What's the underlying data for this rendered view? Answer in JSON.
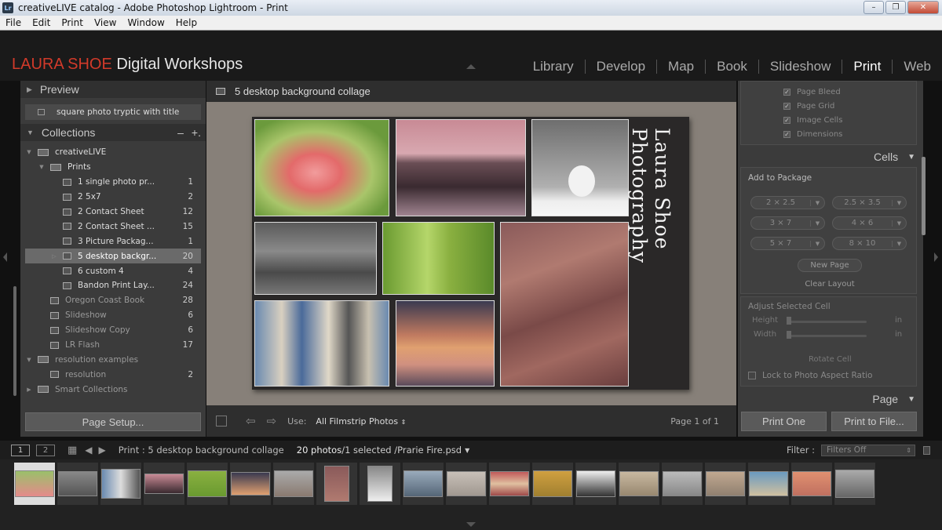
{
  "window": {
    "title": "creativeLIVE catalog - Adobe Photoshop Lightroom - Print",
    "app_icon": "Lr",
    "minimize": "–",
    "maximize": "❐",
    "close": "✕"
  },
  "menu": [
    "File",
    "Edit",
    "Print",
    "View",
    "Window",
    "Help"
  ],
  "brand": {
    "part1": "LAURA SHOE",
    "part2": "Digital Workshops",
    "color1": "#d23a2a"
  },
  "modules": [
    "Library",
    "Develop",
    "Map",
    "Book",
    "Slideshow",
    "Print",
    "Web"
  ],
  "active_module": "Print",
  "left": {
    "preview_label": "Preview",
    "template_label": "square photo tryptic with title",
    "collections_label": "Collections",
    "collections_actions": [
      "–",
      "+."
    ],
    "tree": [
      {
        "label": "creativeLIVE",
        "count": "",
        "depth": 1,
        "type": "set",
        "state": "open"
      },
      {
        "label": "Prints",
        "count": "",
        "depth": 2,
        "type": "set",
        "state": "open"
      },
      {
        "label": "1 single photo pr...",
        "count": "1",
        "depth": 3,
        "type": "print"
      },
      {
        "label": "2 5x7",
        "count": "2",
        "depth": 3,
        "type": "print"
      },
      {
        "label": "2 Contact Sheet",
        "count": "12",
        "depth": 3,
        "type": "print"
      },
      {
        "label": "2 Contact Sheet ...",
        "count": "15",
        "depth": 3,
        "type": "print"
      },
      {
        "label": "3 Picture Packag...",
        "count": "1",
        "depth": 3,
        "type": "print"
      },
      {
        "label": "5 desktop backgr...",
        "count": "20",
        "depth": 3,
        "type": "print",
        "selected": true
      },
      {
        "label": "6 custom 4",
        "count": "4",
        "depth": 3,
        "type": "print"
      },
      {
        "label": "Bandon Print Lay...",
        "count": "24",
        "depth": 3,
        "type": "print"
      },
      {
        "label": "Oregon Coast Book",
        "count": "28",
        "depth": 2,
        "type": "book",
        "dim": true
      },
      {
        "label": "Slideshow",
        "count": "6",
        "depth": 2,
        "type": "slideshow",
        "dim": true
      },
      {
        "label": "Slideshow Copy",
        "count": "6",
        "depth": 2,
        "type": "slideshow",
        "dim": true
      },
      {
        "label": "LR Flash",
        "count": "17",
        "depth": 2,
        "type": "web",
        "dim": true
      },
      {
        "label": "resolution examples",
        "count": "",
        "depth": 1,
        "type": "set",
        "state": "open",
        "dim": true
      },
      {
        "label": "resolution",
        "count": "2",
        "depth": 2,
        "type": "collection",
        "dim": true
      },
      {
        "label": "Smart Collections",
        "count": "",
        "depth": 1,
        "type": "set",
        "state": "closed",
        "dim": true
      }
    ],
    "page_setup": "Page Setup..."
  },
  "center": {
    "title": "5 desktop background collage",
    "vertical_text": "Laura Shoe Photography",
    "footer": {
      "use_label": "Use:",
      "use_value": "All Filmstrip Photos",
      "page": "Page 1 of 1"
    }
  },
  "right": {
    "guides": [
      "Page Bleed",
      "Page Grid",
      "Image Cells",
      "Dimensions"
    ],
    "cells_label": "Cells",
    "add_to_package": "Add to Package",
    "sizes": [
      "2 × 2.5",
      "2.5 × 3.5",
      "3 × 7",
      "4 × 6",
      "5 × 7",
      "8 × 10"
    ],
    "new_page": "New Page",
    "clear_layout": "Clear Layout",
    "adjust_label": "Adjust Selected Cell",
    "height_label": "Height",
    "width_label": "Width",
    "unit": "in",
    "rotate": "Rotate Cell",
    "lock": "Lock to Photo Aspect Ratio",
    "page_label": "Page",
    "print_one": "Print One",
    "print_file": "Print to File..."
  },
  "filmbar": {
    "view1": "1",
    "view2": "2",
    "path": "Print : 5 desktop background collage",
    "photos": "20 photos",
    "selection": "/1 selected /Prarie Fire.psd",
    "filter_label": "Filter :",
    "filter_value": "Filters Off"
  }
}
